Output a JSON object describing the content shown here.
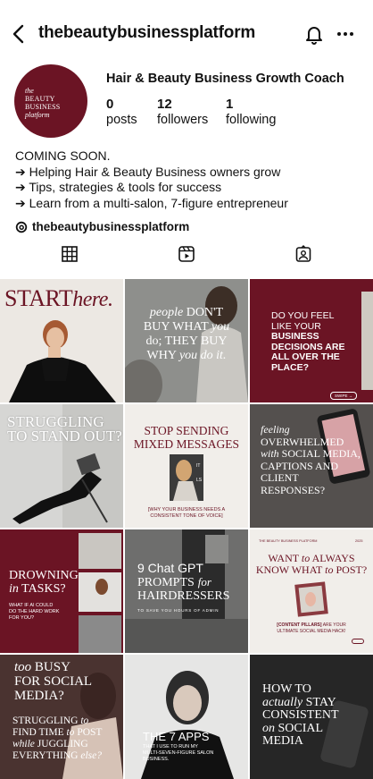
{
  "header": {
    "username": "thebeautybusinessplatform",
    "back_icon": "chevron-left-icon",
    "notifications_icon": "bell-icon",
    "more_icon": "more-horizontal-icon"
  },
  "profile": {
    "avatar_text": [
      "the",
      "BEAUTY BUSINESS",
      "platform"
    ],
    "name": "Hair & Beauty Business Growth Coach",
    "stats": [
      {
        "value": "0",
        "label": "posts"
      },
      {
        "value": "12",
        "label": "followers"
      },
      {
        "value": "1",
        "label": "following"
      }
    ],
    "bio": [
      "COMING SOON.",
      "➔ Helping Hair & Beauty Business owners grow",
      "➔ Tips, strategies & tools for success",
      "➔ Learn from a multi-salon, 7-figure entrepreneur"
    ],
    "threads_handle": "thebeautybusinessplatform"
  },
  "tabs": [
    "grid-icon",
    "reels-icon",
    "tagged-icon"
  ],
  "colors": {
    "brand": "#6b1424",
    "maroon_dark": "#5a1020",
    "text": "#111111"
  },
  "posts": [
    {
      "lines": [
        "START",
        "here."
      ]
    },
    {
      "lines": [
        "people",
        "DON'T",
        "BUY WHAT",
        "you",
        "do; THEY BUY",
        "WHY",
        "you do it."
      ]
    },
    {
      "lines": [
        "DO YOU FEEL",
        "LIKE YOUR",
        "BUSINESS",
        "DECISIONS ARE",
        "ALL OVER THE",
        "PLACE?"
      ],
      "chip": "SWIPE →"
    },
    {
      "lines": [
        "STRUGGLING",
        "TO STAND OUT?"
      ]
    },
    {
      "lines": [
        "STOP SENDING",
        "MIXED MESSAGES",
        "[WHY YOUR BUSINESS NEEDS A",
        "CONSISTENT TONE OF VOICE]"
      ]
    },
    {
      "lines": [
        "feeling",
        "OVERWHELMED",
        "with",
        "SOCIAL MEDIA,",
        "CAPTIONS AND",
        "CLIENT",
        "RESPONSES?"
      ]
    },
    {
      "lines": [
        "DROWNING",
        "in",
        "TASKS?",
        "WHAT IF AI COULD",
        "DO THE HARD WORK",
        "FOR YOU?"
      ]
    },
    {
      "lines": [
        "9 Chat GPT",
        "PROMPTS",
        "for",
        "HAIRDRESSERS",
        "TO SAVE YOU HOURS OF ADMIN"
      ]
    },
    {
      "lines": [
        "THE BEAUTY BUSINESS PLATFORM",
        "2025",
        "WANT",
        "to",
        "ALWAYS",
        "KNOW WHAT",
        "to",
        "POST?",
        "[CONTENT PILLARS]",
        "ARE YOUR",
        "ULTIMATE SOCIAL MEDIA HACK!"
      ]
    },
    {
      "lines": [
        "too",
        "BUSY",
        "FOR SOCIAL",
        "MEDIA?",
        "STRUGGLING",
        "to",
        "FIND TIME",
        "to",
        "POST",
        "while",
        "JUGGLING",
        "EVERYTHING",
        "else?"
      ]
    },
    {
      "lines": [
        "THE 7 APPS",
        "THAT I USE TO RUN MY",
        "MULTI-SEVEN-FIGURE SALON",
        "BUSINESS."
      ]
    },
    {
      "lines": [
        "HOW TO",
        "actually",
        "STAY",
        "CONSISTENT",
        "on",
        "SOCIAL",
        "MEDIA"
      ]
    }
  ]
}
